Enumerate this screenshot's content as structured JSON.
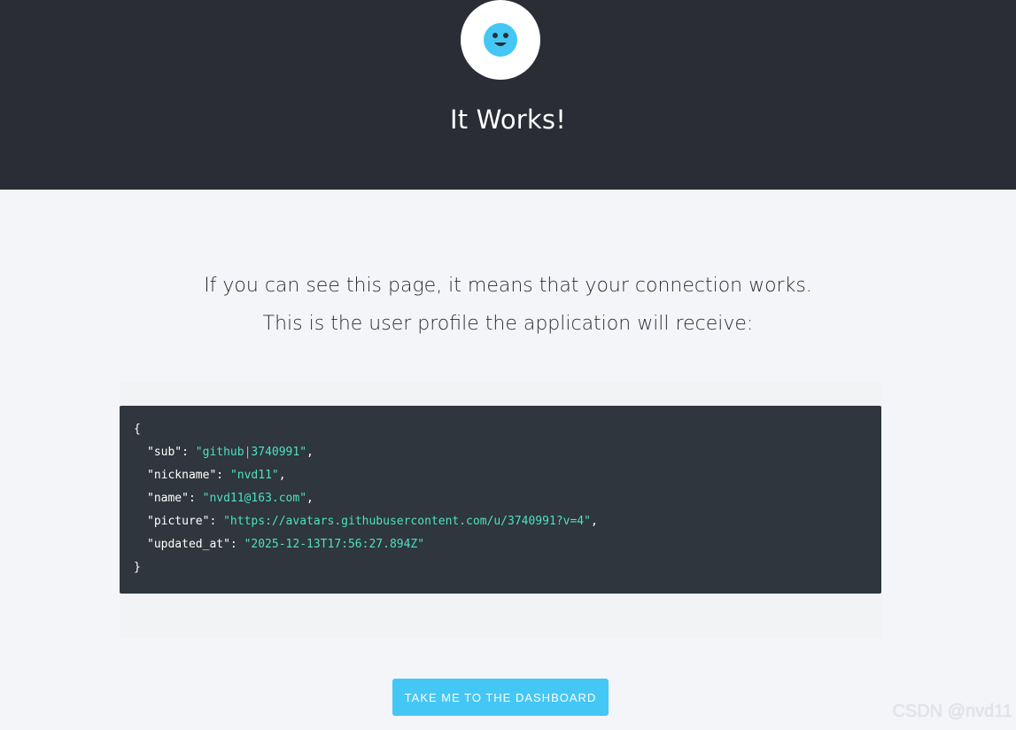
{
  "header": {
    "title": "It Works!",
    "logo_icon": "smiley-face-icon",
    "background": "#2a2d35",
    "logo_color": "#44c7f4"
  },
  "intro": {
    "line1": "If you can see this page, it means that your connection works.",
    "line2": "This is the user profile the application will receive:"
  },
  "profile_json": {
    "open": "{",
    "close": "}",
    "entries": [
      {
        "key": "\"sub\"",
        "value": "\"github|3740991\"",
        "trail": ","
      },
      {
        "key": "\"nickname\"",
        "value": "\"nvd11\"",
        "trail": ","
      },
      {
        "key": "\"name\"",
        "value": "\"nvd11@163.com\"",
        "trail": ","
      },
      {
        "key": "\"picture\"",
        "value": "\"https://avatars.githubusercontent.com/u/3740991?v=4\"",
        "trail": ","
      },
      {
        "key": "\"updated_at\"",
        "value": "\"2025-12-13T17:56:27.894Z\"",
        "trail": ""
      }
    ],
    "string_color": "#4de0c2"
  },
  "actions": {
    "dashboard_button": "TAKE ME TO THE DASHBOARD",
    "button_color": "#44c7f4"
  },
  "watermark": "CSDN @nvd11"
}
